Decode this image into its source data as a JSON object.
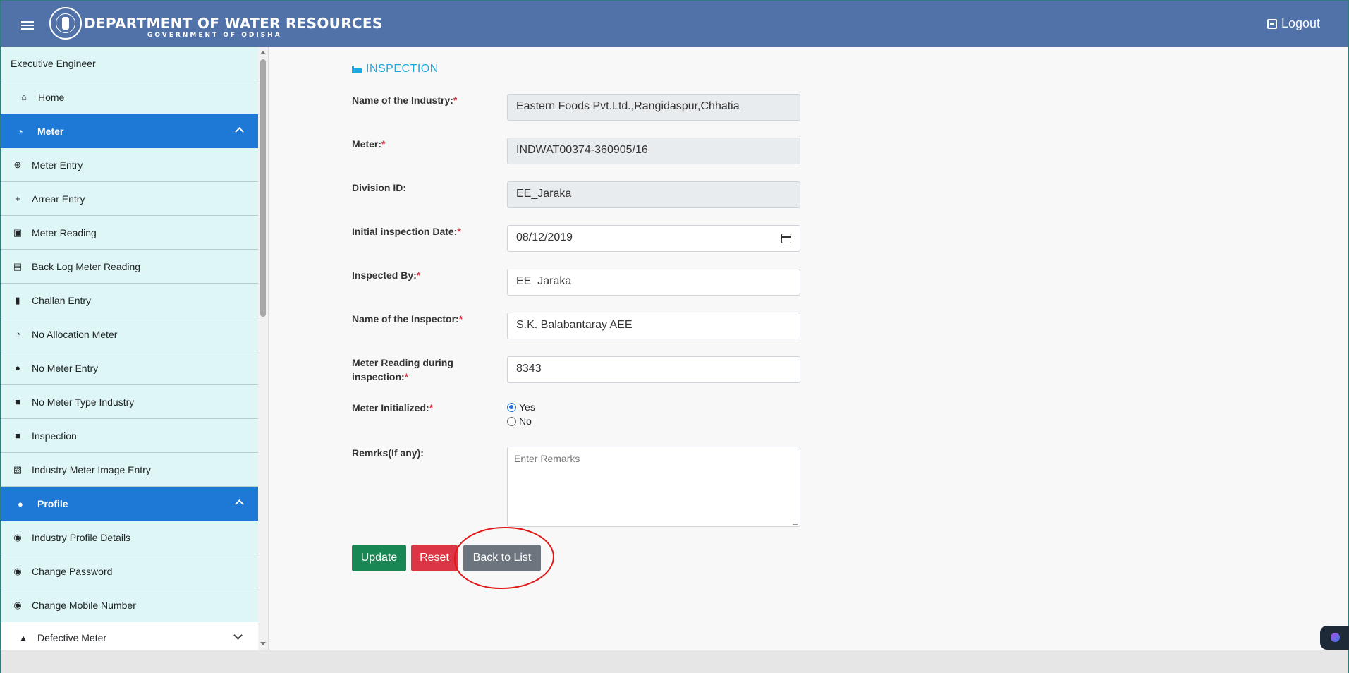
{
  "header": {
    "title": "DEPARTMENT OF WATER RESOURCES",
    "subtitle": "GOVERNMENT OF ODISHA",
    "logout_label": "Logout"
  },
  "sidebar": {
    "user_role": "Executive Engineer",
    "home_label": "Home",
    "meter_group": "Meter",
    "meter_items": [
      {
        "label": "Meter Entry",
        "icon": "plus-circle-icon"
      },
      {
        "label": "Arrear Entry",
        "icon": "plus-icon"
      },
      {
        "label": "Meter Reading",
        "icon": "search-icon"
      },
      {
        "label": "Back Log Meter Reading",
        "icon": "journal-icon"
      },
      {
        "label": "Challan Entry",
        "icon": "file-plus-icon"
      },
      {
        "label": "No Allocation Meter",
        "icon": "speedometer-icon"
      },
      {
        "label": "No Meter Entry",
        "icon": "exclamation-circle-icon"
      },
      {
        "label": "No Meter Type Industry",
        "icon": "briefcase-icon"
      },
      {
        "label": "Inspection",
        "icon": "briefcase-icon"
      },
      {
        "label": "Industry Meter Image Entry",
        "icon": "image-add-icon"
      }
    ],
    "profile_group": "Profile",
    "profile_items": [
      {
        "label": "Industry Profile Details",
        "icon": "user-circle-icon"
      },
      {
        "label": "Change Password",
        "icon": "user-circle-icon"
      },
      {
        "label": "Change Mobile Number",
        "icon": "user-circle-icon"
      }
    ],
    "defective_label": "Defective Meter"
  },
  "form": {
    "section_title": "INSPECTION",
    "industry_label": "Name of the Industry:",
    "industry_value": "Eastern Foods Pvt.Ltd.,Rangidaspur,Chhatia",
    "meter_label": "Meter:",
    "meter_value": "INDWAT00374-360905/16",
    "division_label": "Division ID:",
    "division_value": "EE_Jaraka",
    "date_label": "Initial inspection Date:",
    "date_value": "08/12/2019",
    "inspected_by_label": "Inspected By:",
    "inspected_by_value": "EE_Jaraka",
    "inspector_label": "Name of the Inspector:",
    "inspector_value": "S.K. Balabantaray AEE",
    "reading_label_1": "Meter Reading during",
    "reading_label_2": "inspection:",
    "reading_value": "8343",
    "initialized_label": "Meter Initialized:",
    "radio_yes": "Yes",
    "radio_no": "No",
    "remarks_label": "Remrks(If any):",
    "remarks_placeholder": "Enter Remarks",
    "required_mark": "*"
  },
  "buttons": {
    "update": "Update",
    "reset": "Reset",
    "back": "Back to List"
  },
  "colors": {
    "header_bg": "#5172a8",
    "sidebar_bg": "#dff6f7",
    "active_group": "#1d78d6",
    "update_btn": "#198754",
    "reset_btn": "#dc3545",
    "back_btn": "#6c757d",
    "section_title": "#1aa9e0",
    "annotation": "#e01818"
  }
}
